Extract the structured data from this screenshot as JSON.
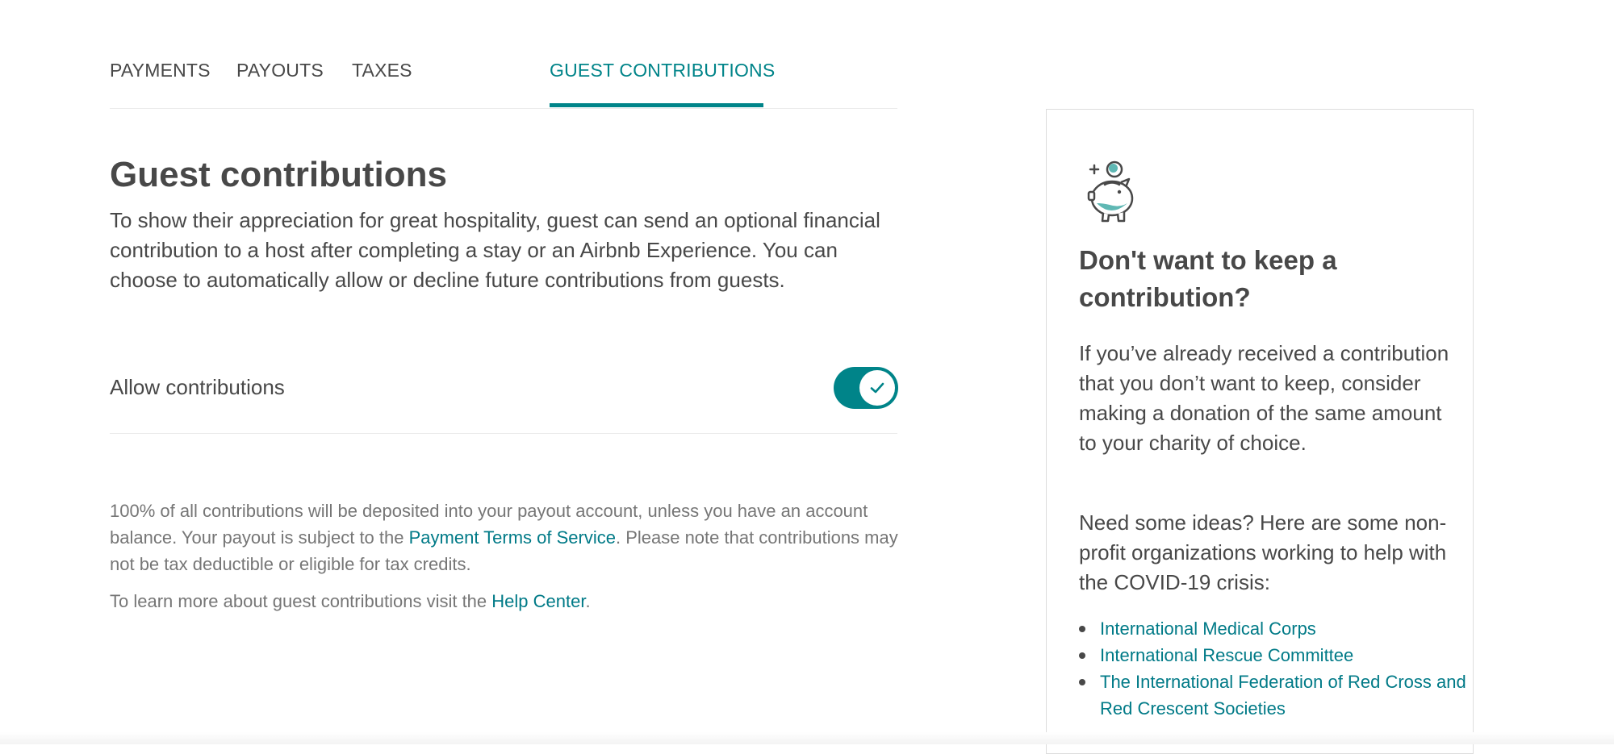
{
  "tabs": [
    {
      "label": "PAYMENTS",
      "active": false
    },
    {
      "label": "PAYOUTS",
      "active": false
    },
    {
      "label": "TAXES",
      "active": false
    },
    {
      "label": "GUEST CONTRIBUTIONS",
      "active": true
    }
  ],
  "main": {
    "title": "Guest contributions",
    "description": "To show their appreciation for great hospitality, guest can send an optional financial contribution to a host after completing a stay or an Airbnb Experience. You can choose to automatically allow or decline future contributions from guests.",
    "allow_label": "Allow contributions",
    "allow_enabled": true,
    "note1_before": "100% of all contributions will be deposited into your payout account, unless you have an account balance. Your payout is subject to the ",
    "note1_link": "Payment Terms of Service",
    "note1_after": ". Please note that contributions may not be tax deductible or eligible for tax credits.",
    "note2_before": "To learn more about guest contributions visit the ",
    "note2_link": "Help Center",
    "note2_after": "."
  },
  "sidebar_card": {
    "icon": "piggy-bank-icon",
    "title": "Don't want to keep a contribution?",
    "paragraph1": "If you’ve already received a contribution that you don’t want to keep, consider making a donation of the same amount to your charity of choice.",
    "paragraph2": "Need some ideas? Here are some non-profit organizations working to help with the COVID-19 crisis:",
    "organizations": [
      "International Medical Corps",
      "International Rescue Committee",
      "The International Federation of Red Cross and Red Crescent Societies"
    ]
  },
  "colors": {
    "accent": "#008489",
    "link": "#007a87",
    "text": "#484848",
    "muted_text": "#767676",
    "divider": "#ebebeb"
  }
}
